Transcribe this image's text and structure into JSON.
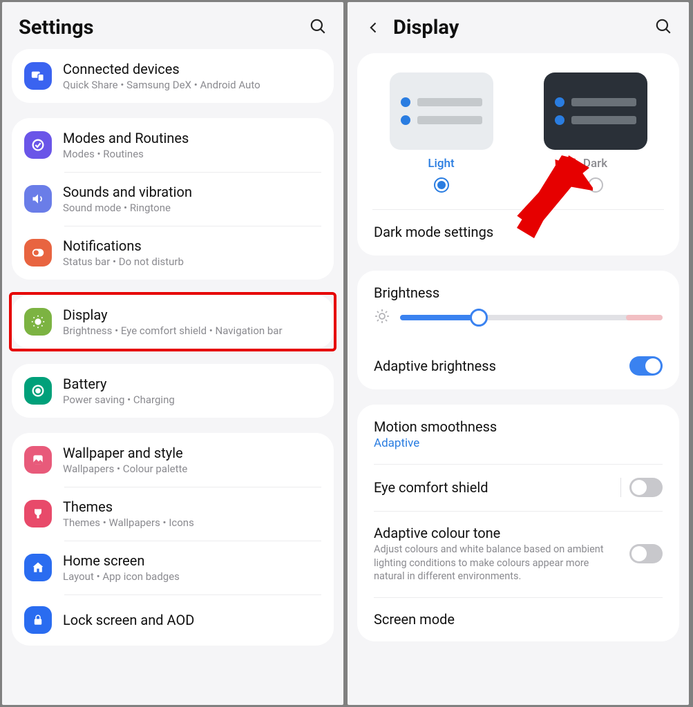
{
  "left": {
    "title": "Settings",
    "groups": [
      {
        "items": [
          {
            "icon": "connected",
            "color": "#3a63f0",
            "title": "Connected devices",
            "sub": "Quick Share  •  Samsung DeX  •  Android Auto"
          }
        ]
      },
      {
        "items": [
          {
            "icon": "modes",
            "color": "#6a55e8",
            "title": "Modes and Routines",
            "sub": "Modes  •  Routines"
          },
          {
            "icon": "sound",
            "color": "#6a7de8",
            "title": "Sounds and vibration",
            "sub": "Sound mode  •  Ringtone"
          },
          {
            "icon": "notif",
            "color": "#e86440",
            "title": "Notifications",
            "sub": "Status bar  •  Do not disturb"
          }
        ]
      },
      {
        "highlight": true,
        "items": [
          {
            "icon": "display",
            "color": "#7cb342",
            "title": "Display",
            "sub": "Brightness  •  Eye comfort shield  •  Navigation bar"
          }
        ]
      },
      {
        "items": [
          {
            "icon": "battery",
            "color": "#00a07a",
            "title": "Battery",
            "sub": "Power saving  •  Charging"
          }
        ]
      },
      {
        "items": [
          {
            "icon": "wallpaper",
            "color": "#e85a7a",
            "title": "Wallpaper and style",
            "sub": "Wallpapers  •  Colour palette"
          },
          {
            "icon": "themes",
            "color": "#e84a6a",
            "title": "Themes",
            "sub": "Themes  •  Wallpapers  •  Icons"
          },
          {
            "icon": "home",
            "color": "#2a6cf0",
            "title": "Home screen",
            "sub": "Layout  •  App icon badges"
          },
          {
            "icon": "lock",
            "color": "#2a6cf0",
            "title": "Lock screen and AOD",
            "sub": ""
          }
        ]
      }
    ]
  },
  "right": {
    "title": "Display",
    "theme": {
      "light": "Light",
      "dark": "Dark",
      "selected": "light"
    },
    "dark_mode_settings": "Dark mode settings",
    "brightness_label": "Brightness",
    "brightness_value": 30,
    "adaptive_brightness": {
      "label": "Adaptive brightness",
      "on": true
    },
    "motion": {
      "label": "Motion smoothness",
      "value": "Adaptive"
    },
    "eye_comfort": {
      "label": "Eye comfort shield",
      "on": false
    },
    "colour_tone": {
      "label": "Adaptive colour tone",
      "desc": "Adjust colours and white balance based on ambient lighting conditions to make colours appear more natural in different environments.",
      "on": false
    },
    "screen_mode": "Screen mode"
  }
}
